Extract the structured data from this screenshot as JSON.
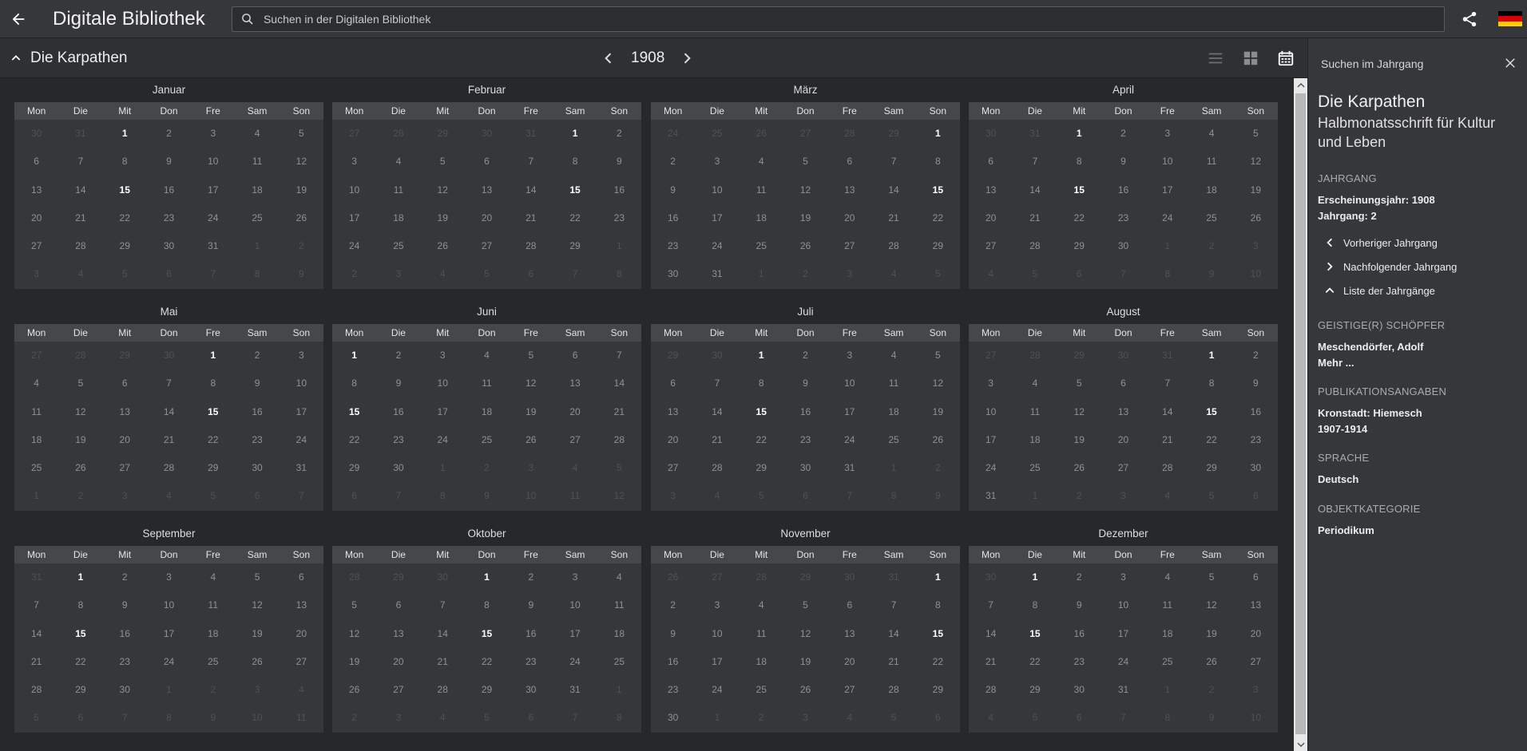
{
  "app": {
    "title": "Digitale Bibliothek"
  },
  "search": {
    "placeholder": "Suchen in der Digitalen Bibliothek"
  },
  "subheader": {
    "title": "Die Karpathen",
    "year": "1908"
  },
  "weekdays": [
    "Mon",
    "Die",
    "Mit",
    "Don",
    "Fre",
    "Sam",
    "Son"
  ],
  "months": [
    {
      "name": "Januar",
      "prev_days": [
        30,
        31
      ],
      "days": 31,
      "highlights": [
        1,
        15
      ]
    },
    {
      "name": "Februar",
      "prev_days": [
        27,
        28,
        29,
        30,
        31
      ],
      "days": 29,
      "highlights": [
        1,
        15
      ]
    },
    {
      "name": "März",
      "prev_days": [
        24,
        25,
        26,
        27,
        28,
        29
      ],
      "days": 31,
      "highlights": [
        1,
        15
      ]
    },
    {
      "name": "April",
      "prev_days": [
        30,
        31
      ],
      "days": 30,
      "highlights": [
        1,
        15
      ]
    },
    {
      "name": "Mai",
      "prev_days": [
        27,
        28,
        29,
        30
      ],
      "days": 31,
      "highlights": [
        1,
        15
      ]
    },
    {
      "name": "Juni",
      "prev_days": [],
      "days": 30,
      "highlights": [
        1,
        15
      ]
    },
    {
      "name": "Juli",
      "prev_days": [
        29,
        30
      ],
      "days": 31,
      "highlights": [
        1,
        15
      ]
    },
    {
      "name": "August",
      "prev_days": [
        27,
        28,
        29,
        30,
        31
      ],
      "days": 31,
      "highlights": [
        1,
        15
      ]
    },
    {
      "name": "September",
      "prev_days": [
        31
      ],
      "days": 30,
      "highlights": [
        1,
        15
      ]
    },
    {
      "name": "Oktober",
      "prev_days": [
        28,
        29,
        30
      ],
      "days": 31,
      "highlights": [
        1,
        15
      ]
    },
    {
      "name": "November",
      "prev_days": [
        26,
        27,
        28,
        29,
        30,
        31
      ],
      "days": 30,
      "highlights": [
        1,
        15
      ]
    },
    {
      "name": "Dezember",
      "prev_days": [
        30
      ],
      "days": 31,
      "highlights": [
        1,
        15
      ]
    }
  ],
  "panel": {
    "title": "Suchen im Jahrgang",
    "work_title": "Die Karpathen",
    "work_subtitle": "Halbmonatsschrift für Kultur und Leben",
    "jahrgang_label": "JAHRGANG",
    "erscheinungsjahr": "Erscheinungsjahr: 1908",
    "jahrgang": "Jahrgang: 2",
    "prev_link": "Vorheriger Jahrgang",
    "next_link": "Nachfolgender Jahrgang",
    "list_link": "Liste der Jahrgänge",
    "creator_label": "GEISTIGE(R) SCHÖPFER",
    "creator": "Meschendörfer, Adolf",
    "more": "Mehr ...",
    "pub_label": "PUBLIKATIONSANGABEN",
    "pub_place": "Kronstadt: Hiemesch",
    "pub_years": "1907-1914",
    "lang_label": "SPRACHE",
    "lang": "Deutsch",
    "cat_label": "OBJEKTKATEGORIE",
    "cat": "Periodikum"
  },
  "colors": {
    "background": "#26282b",
    "topbar": "#35373b",
    "month_header": "#45474b",
    "cell": "#35373b",
    "flag_black": "#000000",
    "flag_red": "#dd0000",
    "flag_gold": "#ffce00"
  }
}
